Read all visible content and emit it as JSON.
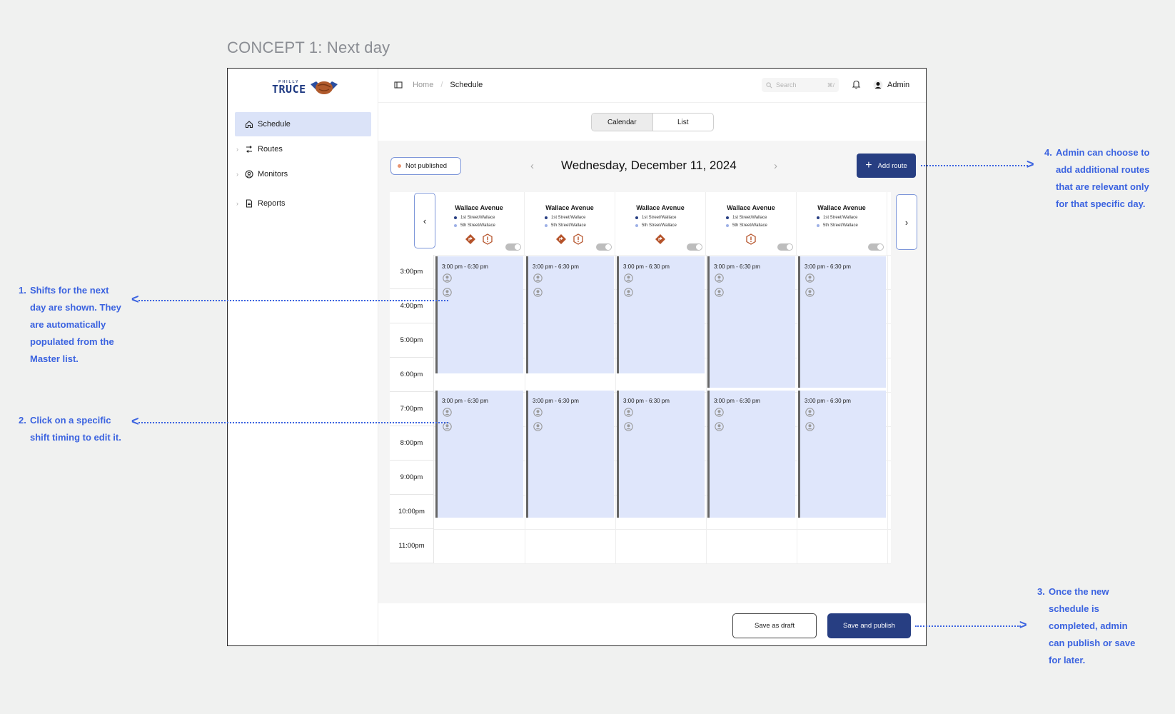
{
  "concept_title": "CONCEPT 1: Next day",
  "logo": {
    "top": "PHILLY",
    "main": "TRUCE"
  },
  "sidebar": {
    "items": [
      {
        "label": "Schedule",
        "icon": "home-icon",
        "active": true
      },
      {
        "label": "Routes",
        "icon": "routes-icon"
      },
      {
        "label": "Monitors",
        "icon": "user-circle-icon"
      },
      {
        "label": "Reports",
        "icon": "document-icon"
      }
    ]
  },
  "topbar": {
    "home": "Home",
    "separator": "/",
    "current": "Schedule",
    "search_placeholder": "Search",
    "search_shortcut": "⌘/",
    "user": "Admin"
  },
  "view_toggle": {
    "calendar": "Calendar",
    "list": "List",
    "selected": "Calendar"
  },
  "status_badge": "Not published",
  "date": "Wednesday, December 11, 2024",
  "add_route": "Add route",
  "routes": [
    {
      "name": "Wallace Avenue",
      "stop1": "1st Street/Wallace",
      "stop2": "5th Street/Wallace"
    },
    {
      "name": "Wallace Avenue",
      "stop1": "1st Street/Wallace",
      "stop2": "5th Street/Wallace"
    },
    {
      "name": "Wallace Avenue",
      "stop1": "1st Street/Wallace",
      "stop2": "5th Street/Wallace"
    },
    {
      "name": "Wallace Avenue",
      "stop1": "1st Street/Wallace",
      "stop2": "5th Street/Wallace"
    },
    {
      "name": "Wallace Avenue",
      "stop1": "1st Street/Wallace",
      "stop2": "5th Street/Wallace"
    }
  ],
  "times": [
    "3:00pm",
    "4:00pm",
    "5:00pm",
    "6:00pm",
    "7:00pm",
    "8:00pm",
    "9:00pm",
    "10:00pm",
    "11:00pm"
  ],
  "shift_label": "3:00 pm - 6:30 pm",
  "footer": {
    "draft": "Save as draft",
    "publish": "Save and publish"
  },
  "annotations": {
    "a1": {
      "num": "1.",
      "text": "Shifts for the next day are shown. They are automatically populated from the Master list."
    },
    "a2": {
      "num": "2.",
      "text": "Click on a specific shift timing to edit it."
    },
    "a3": {
      "num": "3.",
      "text": "Once the new schedule is completed, admin can publish or save for later."
    },
    "a4": {
      "num": "4.",
      "text": "Admin can choose to add additional routes that are relevant only for that specific day."
    }
  },
  "colors": {
    "accent": "#273e82",
    "shift_bg": "#dfe6fb",
    "annotation": "#3b63e0",
    "warning": "#b5532a"
  }
}
